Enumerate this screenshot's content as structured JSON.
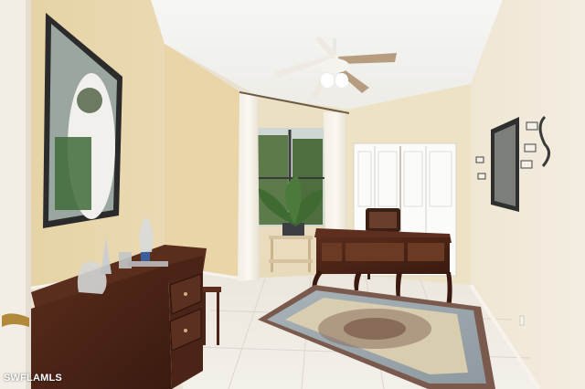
{
  "photo": {
    "watermark": "SWFLAMLS"
  }
}
